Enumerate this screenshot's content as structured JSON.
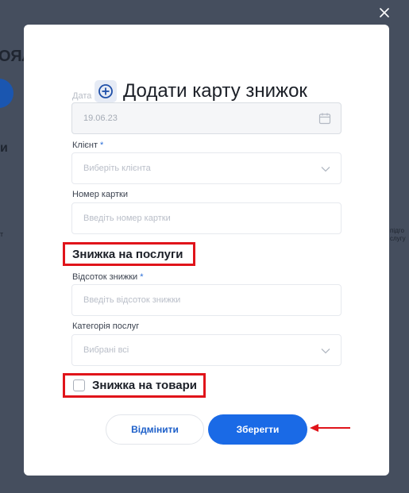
{
  "background": {
    "fragment_top": "ОЯЛ",
    "fragment_mid": "и",
    "fragment_small_left": "т",
    "fragment_small_right": "підго\nслугу"
  },
  "modal": {
    "title": "Додати карту знижок",
    "title_icon": "plus-circle-icon",
    "close_icon": "close-icon"
  },
  "form": {
    "date": {
      "label": "Дата",
      "value": "19.06.23",
      "icon": "calendar-icon"
    },
    "client": {
      "label": "Клієнт",
      "required_mark": "*",
      "placeholder": "Виберіть клієнта",
      "icon": "chevron-down-icon"
    },
    "card_number": {
      "label": "Номер картки",
      "placeholder": "Введіть номер картки"
    },
    "services_section": {
      "title": "Знижка на послуги"
    },
    "discount_percent": {
      "label": "Відсоток знижки",
      "required_mark": "*",
      "placeholder": "Введіть відсоток знижки"
    },
    "service_category": {
      "label": "Категорія послуг",
      "value": "Вибрані всі",
      "icon": "chevron-down-icon"
    },
    "goods_section": {
      "title": "Знижка на товари",
      "checked": false
    }
  },
  "buttons": {
    "cancel": "Відмінити",
    "save": "Зберегти"
  },
  "colors": {
    "overlay": "#454e5e",
    "primary": "#1a6ae6",
    "highlight": "#e0141a"
  }
}
